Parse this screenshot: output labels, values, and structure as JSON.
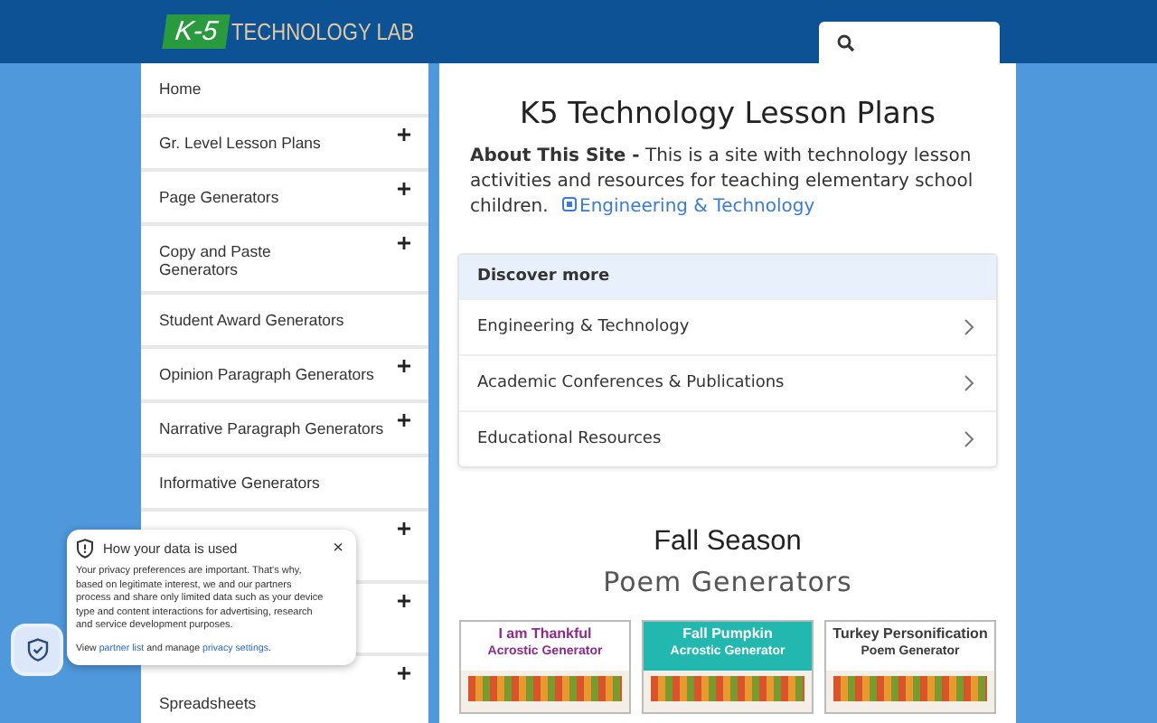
{
  "header": {
    "logo_badge": "K-5",
    "logo_text": "TECHNOLOGY LAB",
    "search": {
      "placeholder_icon": true
    }
  },
  "sidebar": {
    "items": [
      {
        "label": "Home",
        "expandable": false
      },
      {
        "label": "Gr. Level Lesson Plans",
        "expandable": true
      },
      {
        "label": "Page Generators",
        "expandable": true
      },
      {
        "label": "Copy and Paste\nGenerators",
        "expandable": true
      },
      {
        "label": "Student Award Generators",
        "expandable": false
      },
      {
        "label": "Opinion Paragraph Generators",
        "expandable": true
      },
      {
        "label": "Narrative Paragraph Generators",
        "expandable": true
      },
      {
        "label": "Informative Generators",
        "expandable": false
      },
      {
        "expandable": true
      },
      {
        "expandable": true
      },
      {
        "label": "Spreadsheets",
        "expandable": true
      }
    ]
  },
  "main": {
    "title": "K5 Technology Lesson Plans",
    "about": "**About This Site -** This is a site with technology lesson activities and resources for teaching elementary school children.",
    "about_link": "Engineering & Technology",
    "discover": {
      "heading": "Discover more",
      "items": [
        "Engineering & Technology",
        "Academic Conferences & Publications",
        "Educational Resources"
      ]
    },
    "section_title": "Fall Season",
    "section_subtitle": "Poem Generators",
    "thumbnails": [
      {
        "title": "I am Thankful",
        "subtitle": "Acrostic Generator",
        "color": "#ffffff"
      },
      {
        "title": "Fall Pumpkin",
        "subtitle": "Acrostic Generator",
        "color": "#22b8b0"
      },
      {
        "title": "Turkey Personification",
        "subtitle": "Poem Generator",
        "color": "#ffffff"
      }
    ]
  },
  "privacy": {
    "title": "How your data is used",
    "body": "Your privacy preferences are important. That's why, based on legitimate interest, we and our partners process and share only limited data such as your device type and content interactions for advertising, research and service development purposes.",
    "view": "View",
    "partner_link": "partner list",
    "manage": "and manage",
    "settings_link": "privacy settings",
    "end": ".",
    "close": "×"
  }
}
